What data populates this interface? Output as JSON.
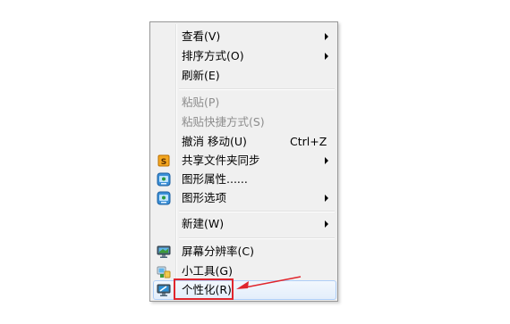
{
  "menu": {
    "items": [
      {
        "label": "查看(V)",
        "has_submenu": true
      },
      {
        "label": "排序方式(O)",
        "has_submenu": true
      },
      {
        "label": "刷新(E)"
      },
      {
        "label": "粘贴(P)",
        "disabled": true
      },
      {
        "label": "粘贴快捷方式(S)",
        "disabled": true
      },
      {
        "label": "撤消 移动(U)",
        "shortcut": "Ctrl+Z"
      },
      {
        "label": "共享文件夹同步",
        "icon": "sync-folder-icon",
        "icon_letter": "S",
        "has_submenu": true
      },
      {
        "label": "图形属性......",
        "icon": "graphics-properties-icon"
      },
      {
        "label": "图形选项",
        "icon": "graphics-options-icon",
        "has_submenu": true
      },
      {
        "label": "新建(W)",
        "has_submenu": true
      },
      {
        "label": "屏幕分辨率(C)",
        "icon": "monitor-icon"
      },
      {
        "label": "小工具(G)",
        "icon": "gadgets-icon"
      },
      {
        "label": "个性化(R)",
        "icon": "personalize-icon",
        "highlighted": true
      }
    ]
  },
  "annotation": {
    "highlight_color": "#e0262d"
  },
  "colors": {
    "menu_background": "#f0f0f0",
    "menu_border": "#979797",
    "disabled_text": "#8d8d8d",
    "hover_border": "#aecef7"
  }
}
